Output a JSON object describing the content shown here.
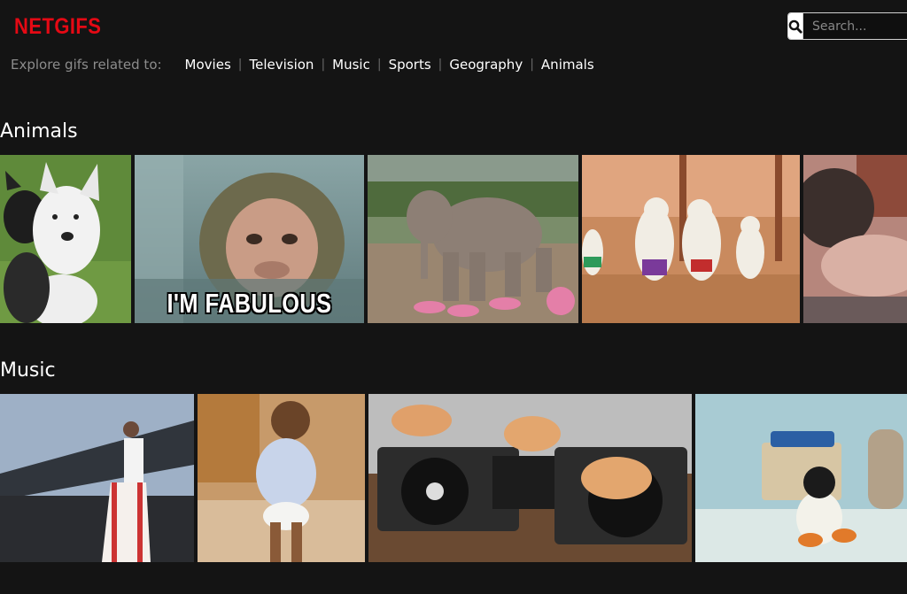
{
  "brand": {
    "logo_text": "NETGIFS",
    "color": "#e50914"
  },
  "search": {
    "placeholder": "Search...",
    "icon": "search-icon"
  },
  "explore": {
    "label": "Explore gifs related to:",
    "categories": [
      "Movies",
      "Television",
      "Music",
      "Sports",
      "Geography",
      "Animals"
    ]
  },
  "sections": [
    {
      "title": "Animals",
      "tiles": [
        {
          "name": "gif-dogs",
          "caption": ""
        },
        {
          "name": "gif-monkey-fabulous",
          "caption": "I'M FABULOUS"
        },
        {
          "name": "gif-elephant-sneakers",
          "caption": ""
        },
        {
          "name": "gif-dancing-poodles",
          "caption": ""
        },
        {
          "name": "gif-cat-sleeping",
          "caption": ""
        }
      ]
    },
    {
      "title": "Music",
      "tiles": [
        {
          "name": "gif-freddie-mercury",
          "caption": ""
        },
        {
          "name": "gif-dancing-baby",
          "caption": ""
        },
        {
          "name": "gif-dj-kittens",
          "caption": ""
        },
        {
          "name": "gif-pingu-record-player",
          "caption": ""
        }
      ]
    }
  ]
}
